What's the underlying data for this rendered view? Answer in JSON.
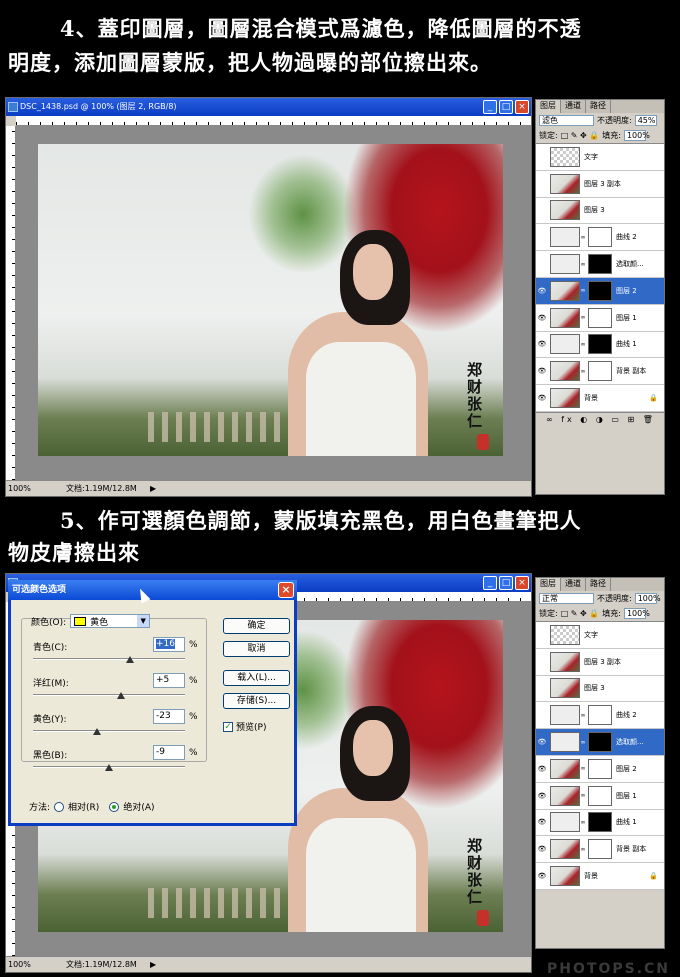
{
  "captions": {
    "step4_line1": "4、蓋印圖層，圖層混合模式爲濾色，降低圖層的不透",
    "step4_line2": "明度，添加圖層蒙版，把人物過曝的部位擦出來。",
    "step5_line1": "5、作可選顏色調節，蒙版填充黑色，用白色畫筆把人",
    "step5_line2": "物皮膚擦出來"
  },
  "window": {
    "title": "DSC_1438.psd @ 100% (图层 2, RGB/8)",
    "zoom": "100%",
    "doc_info": "文档:1.19M/12.8M"
  },
  "window2": {
    "zoom": "100%",
    "doc_info": "文档:1.19M/12.8M"
  },
  "layers_panel_1": {
    "tabs": [
      "图层",
      "通道",
      "路径"
    ],
    "blend_mode": "滤色",
    "opacity_label": "不透明度:",
    "opacity": "45%",
    "lock_label": "锁定:",
    "fill_label": "填充:",
    "fill": "100%",
    "layers": [
      {
        "name": "文字",
        "visible": false
      },
      {
        "name": "图层 3 副本",
        "visible": false
      },
      {
        "name": "图层 3",
        "visible": false
      },
      {
        "name": "曲线 2",
        "visible": false
      },
      {
        "name": "选取颜...",
        "visible": false
      },
      {
        "name": "图层 2",
        "visible": true,
        "selected": true
      },
      {
        "name": "图层 1",
        "visible": true
      },
      {
        "name": "曲线 1",
        "visible": true
      },
      {
        "name": "背景 副本",
        "visible": true
      },
      {
        "name": "背景",
        "visible": true
      }
    ]
  },
  "layers_panel_2": {
    "tabs": [
      "图层",
      "通道",
      "路径"
    ],
    "blend_mode": "正常",
    "opacity_label": "不透明度:",
    "opacity": "100%",
    "lock_label": "锁定:",
    "fill_label": "填充:",
    "fill": "100%",
    "layers": [
      {
        "name": "文字",
        "visible": false
      },
      {
        "name": "图层 3 副本",
        "visible": false
      },
      {
        "name": "图层 3",
        "visible": false
      },
      {
        "name": "曲线 2",
        "visible": false
      },
      {
        "name": "选取颜...",
        "visible": true,
        "selected": true
      },
      {
        "name": "图层 2",
        "visible": true
      },
      {
        "name": "图层 1",
        "visible": true
      },
      {
        "name": "曲线 1",
        "visible": true
      },
      {
        "name": "背景 副本",
        "visible": true
      },
      {
        "name": "背景",
        "visible": true
      }
    ]
  },
  "signature_text": "郑财张仁",
  "dialog": {
    "title": "可选颜色选项",
    "colors_label": "颜色(O):",
    "colors_value": "黄色",
    "swatch_color": "#ffff00",
    "sliders": [
      {
        "label": "青色(C):",
        "value": "+16",
        "percent": 0.58
      },
      {
        "label": "洋红(M):",
        "value": "+5",
        "percent": 0.52
      },
      {
        "label": "黄色(Y):",
        "value": "-23",
        "percent": 0.38
      },
      {
        "label": "黑色(B):",
        "value": "-9",
        "percent": 0.45
      }
    ],
    "pct": "%",
    "buttons": {
      "ok": "确定",
      "cancel": "取消",
      "load": "载入(L)...",
      "save": "存储(S)..."
    },
    "preview_label": "预览(P)",
    "method_label": "方法:",
    "relative_label": "相对(R)",
    "absolute_label": "绝对(A)"
  },
  "watermark": "PHOTOPS.CN"
}
